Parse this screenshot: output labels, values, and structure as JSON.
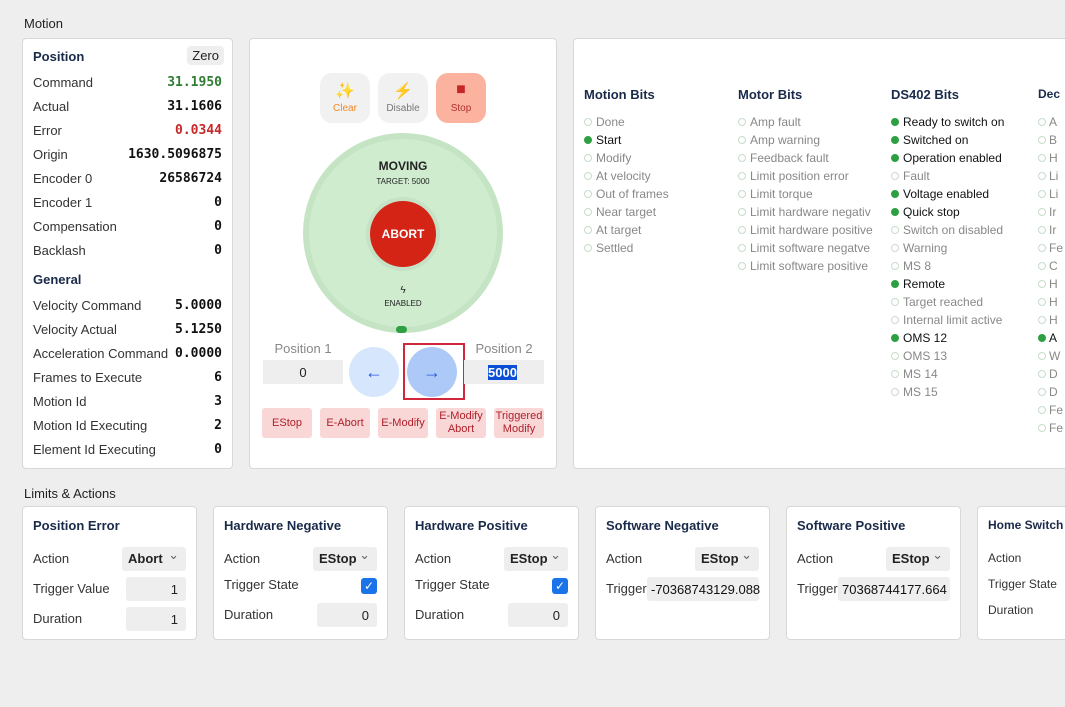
{
  "motion": {
    "title": "Motion",
    "position": {
      "title": "Position",
      "zero_label": "Zero",
      "rows": [
        {
          "label": "Command",
          "value": "31.1950",
          "color": "#2e7d32"
        },
        {
          "label": "Actual",
          "value": "31.1606",
          "color": "#111111"
        },
        {
          "label": "Error",
          "value": "0.0344",
          "color": "#c62828"
        },
        {
          "label": "Origin",
          "value": "1630.5096875",
          "color": "#111111"
        },
        {
          "label": "Encoder 0",
          "value": "26586724",
          "color": "#111111"
        },
        {
          "label": "Encoder 1",
          "value": "0",
          "color": "#111111"
        },
        {
          "label": "Compensation",
          "value": "0",
          "color": "#111111"
        },
        {
          "label": "Backlash",
          "value": "0",
          "color": "#111111"
        }
      ]
    },
    "general": {
      "title": "General",
      "rows": [
        {
          "label": "Velocity Command",
          "value": "5.0000"
        },
        {
          "label": "Velocity Actual",
          "value": "5.1250"
        },
        {
          "label": "Acceleration Command",
          "value": "0.0000"
        },
        {
          "label": "Frames to Execute",
          "value": "6"
        },
        {
          "label": "Motion Id",
          "value": "3"
        },
        {
          "label": "Motion Id Executing",
          "value": "2"
        },
        {
          "label": "Element Id Executing",
          "value": "0"
        }
      ]
    },
    "control": {
      "clear": "Clear",
      "disable": "Disable",
      "stop": "Stop",
      "state": "MOVING",
      "target": "TARGET: 5000",
      "abort": "ABORT",
      "enabled": "ENABLED",
      "position1_label": "Position 1",
      "position1_value": "0",
      "position2_label": "Position 2",
      "position2_value": "5000",
      "actions": [
        "EStop",
        "E-Abort",
        "E-Modify",
        "E-Modify Abort",
        "Triggered Modify"
      ]
    },
    "bits": [
      {
        "title": "Motion Bits",
        "items": [
          {
            "l": "Done",
            "on": false
          },
          {
            "l": "Start",
            "on": true
          },
          {
            "l": "Modify",
            "on": false
          },
          {
            "l": "At velocity",
            "on": false
          },
          {
            "l": "Out of frames",
            "on": false
          },
          {
            "l": "Near target",
            "on": false
          },
          {
            "l": "At target",
            "on": false
          },
          {
            "l": "Settled",
            "on": false
          }
        ]
      },
      {
        "title": "Motor Bits",
        "items": [
          {
            "l": "Amp fault",
            "on": false
          },
          {
            "l": "Amp warning",
            "on": false
          },
          {
            "l": "Feedback fault",
            "on": false
          },
          {
            "l": "Limit position error",
            "on": false
          },
          {
            "l": "Limit torque",
            "on": false
          },
          {
            "l": "Limit hardware negativ",
            "on": false
          },
          {
            "l": "Limit hardware positive",
            "on": false
          },
          {
            "l": "Limit software negatve",
            "on": false
          },
          {
            "l": "Limit software positive",
            "on": false
          }
        ]
      },
      {
        "title": "DS402 Bits",
        "items": [
          {
            "l": "Ready to switch on",
            "on": true
          },
          {
            "l": "Switched on",
            "on": true
          },
          {
            "l": "Operation enabled",
            "on": true
          },
          {
            "l": "Fault",
            "on": false
          },
          {
            "l": "Voltage enabled",
            "on": true
          },
          {
            "l": "Quick stop",
            "on": true
          },
          {
            "l": "Switch on disabled",
            "on": false
          },
          {
            "l": "Warning",
            "on": false
          },
          {
            "l": "MS 8",
            "on": false
          },
          {
            "l": "Remote",
            "on": true
          },
          {
            "l": "Target reached",
            "on": false
          },
          {
            "l": "Internal limit active",
            "on": false
          },
          {
            "l": "OMS 12",
            "on": true
          },
          {
            "l": "OMS 13",
            "on": false
          },
          {
            "l": "MS 14",
            "on": false
          },
          {
            "l": "MS 15",
            "on": false
          }
        ]
      },
      {
        "title": "Dec",
        "items": [
          {
            "l": "A",
            "on": false
          },
          {
            "l": "B",
            "on": false
          },
          {
            "l": "H",
            "on": false
          },
          {
            "l": "Li",
            "on": false
          },
          {
            "l": "Li",
            "on": false
          },
          {
            "l": "Ir",
            "on": false
          },
          {
            "l": "Ir",
            "on": false
          },
          {
            "l": "Fe",
            "on": false
          },
          {
            "l": "C",
            "on": false
          },
          {
            "l": "H",
            "on": false
          },
          {
            "l": "H",
            "on": false
          },
          {
            "l": "H",
            "on": false
          },
          {
            "l": "A",
            "on": true
          },
          {
            "l": "W",
            "on": false
          },
          {
            "l": "D",
            "on": false
          },
          {
            "l": "D",
            "on": false
          },
          {
            "l": "Fe",
            "on": false
          },
          {
            "l": "Fe",
            "on": false
          }
        ]
      }
    ]
  },
  "limits": {
    "title": "Limits & Actions",
    "cards": [
      {
        "title": "Position Error",
        "action": "Abort",
        "rows": [
          {
            "label": "Trigger Value",
            "value": "1"
          },
          {
            "label": "Duration",
            "value": "1"
          }
        ]
      },
      {
        "title": "Hardware Negative",
        "action": "EStop",
        "trigger_state_label": "Trigger State",
        "trigger_state": true,
        "rows": [
          {
            "label": "Duration",
            "value": "0"
          }
        ]
      },
      {
        "title": "Hardware Positive",
        "action": "EStop",
        "trigger_state_label": "Trigger State",
        "trigger_state": true,
        "rows": [
          {
            "label": "Duration",
            "value": "0"
          }
        ]
      },
      {
        "title": "Software Negative",
        "action": "EStop",
        "rows": [
          {
            "label": "Trigger Value",
            "value": "-70368743129.088"
          }
        ]
      },
      {
        "title": "Software Positive",
        "action": "EStop",
        "rows": [
          {
            "label": "Trigger Value",
            "value": "70368744177.664"
          }
        ]
      },
      {
        "title": "Home Switch",
        "action_label": "Action",
        "trigger_state_label": "Trigger State",
        "duration_label": "Duration"
      }
    ],
    "action_label": "Action"
  }
}
